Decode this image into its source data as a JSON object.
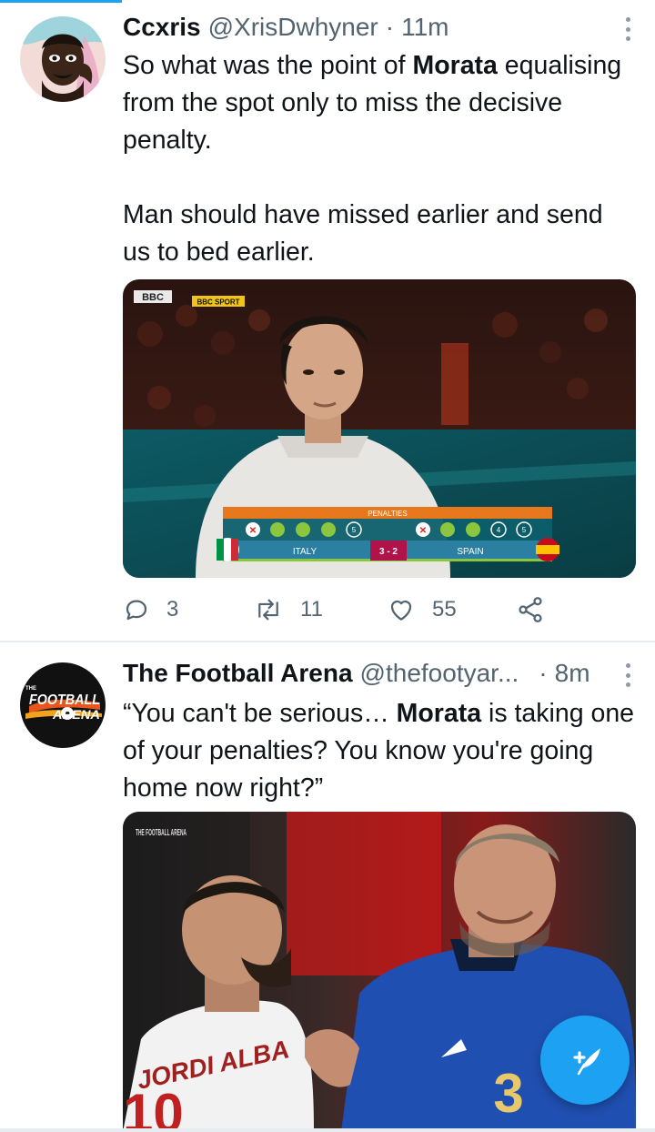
{
  "tweets": [
    {
      "name": "Ccxris",
      "handle": "@XrisDwhyner",
      "separator": "·",
      "time": "11m",
      "text": {
        "line1_pre": "So what was the point of ",
        "line1_bold": "Morata",
        "line1_post": " equalising from the spot only to miss the decisive penalty.",
        "para2": "Man should have missed earlier and send us to bed earlier."
      },
      "media": {
        "broadcaster_logo": "BBC",
        "broadcaster_sport": "BBC SPORT",
        "scoreboard": {
          "title": "PENALTIES",
          "home_team": "ITALY",
          "away_team": "SPAIN",
          "score": "3 - 2",
          "home_kicks": [
            "miss",
            "goal",
            "goal",
            "goal",
            "5"
          ],
          "away_kicks": [
            "miss",
            "goal",
            "goal",
            "4",
            "5"
          ]
        }
      },
      "actions": {
        "replies": "3",
        "retweets": "11",
        "likes": "55"
      }
    },
    {
      "name": "The Football Arena",
      "handle": "@thefootyar...",
      "separator": "·",
      "time": "8m",
      "avatar_text": {
        "line1": "FOOTBALL",
        "line2": "ARENA",
        "prefix": "THE"
      },
      "text": {
        "pre": "“You can't be serious… ",
        "bold": "Morata",
        "post": " is taking one of your penalties? You know you're going home now right?”"
      },
      "media": {
        "watermark": "THE FOOTBALL ARENA",
        "jersey_left_name": "JORDI ALBA",
        "jersey_left_number": "10",
        "jersey_right_number": "3"
      }
    }
  ],
  "colors": {
    "accent": "#1da1f2",
    "text_primary": "#0f1419",
    "text_secondary": "#536471",
    "divider": "#e6ecf0"
  },
  "icons": [
    "reply-icon",
    "retweet-icon",
    "like-icon",
    "share-icon",
    "more-icon",
    "compose-tweet-icon"
  ]
}
